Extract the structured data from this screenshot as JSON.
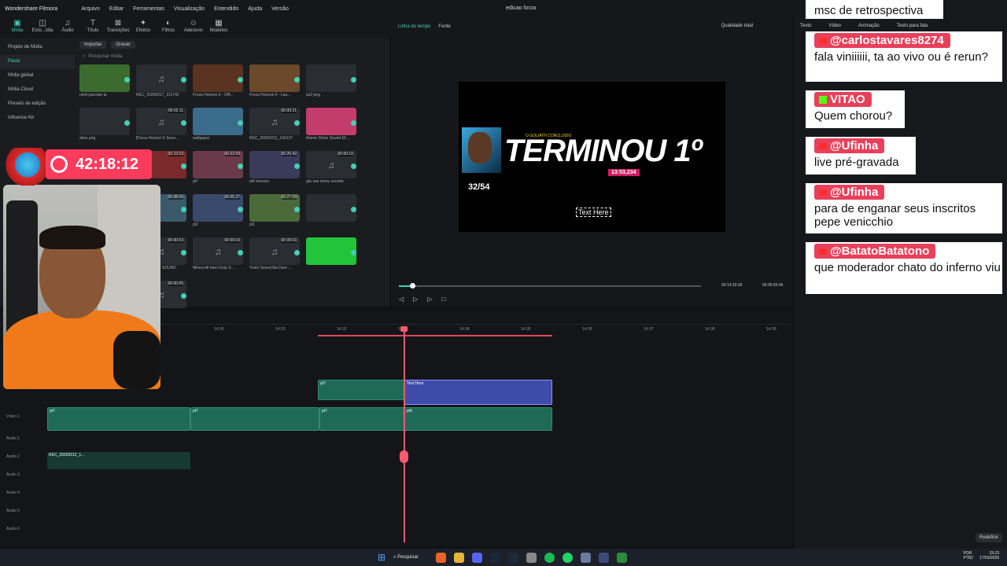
{
  "app": {
    "title": "Wondershare Filmora",
    "doc_title": "edicao forza"
  },
  "menu": [
    "Arquivo",
    "Editar",
    "Ferramentas",
    "Visualização",
    "Estendido",
    "Ajuda",
    "Versão"
  ],
  "toolbar": [
    {
      "icon": "media-icon",
      "label": "Mídia"
    },
    {
      "icon": "stock-icon",
      "label": "Esto...ídia"
    },
    {
      "icon": "audio-icon",
      "label": "Áudio"
    },
    {
      "icon": "title-icon",
      "label": "Título"
    },
    {
      "icon": "transition-icon",
      "label": "Transições"
    },
    {
      "icon": "effects-icon",
      "label": "Efeitos"
    },
    {
      "icon": "filters-icon",
      "label": "Filtros"
    },
    {
      "icon": "stickers-icon",
      "label": "Adesivos"
    },
    {
      "icon": "templates-icon",
      "label": "Modelos"
    }
  ],
  "sidebar": {
    "items": [
      "Projeto de Mídia",
      "Pasta",
      "Mídia global",
      "Mídia Cloud",
      "Presets de edição",
      "Influence Kit"
    ]
  },
  "media": {
    "import": "Importar",
    "record": "Gravar",
    "search_placeholder": "Pesquisar mídia",
    "items": [
      {
        "name": "nerd pacman ia",
        "dur": "",
        "icon": "image-icon"
      },
      {
        "name": "REC_20260217_211742",
        "dur": "",
        "icon": "music-icon"
      },
      {
        "name": "Forza Horizon 6 - Offi...",
        "dur": "",
        "icon": "video-icon"
      },
      {
        "name": "Forza Horizon 5 - Lau...",
        "dur": "",
        "icon": "video-icon"
      },
      {
        "name": "ps3 png",
        "dur": "",
        "icon": "image-icon"
      },
      {
        "name": "xbox png",
        "dur": "",
        "icon": "image-icon"
      },
      {
        "name": "[Forza Horizon 5 Soun...",
        "dur": "00:02:11",
        "icon": "music-icon"
      },
      {
        "name": "wallpaper",
        "dur": "",
        "icon": "image-icon"
      },
      {
        "name": "REC_20260212_160137",
        "dur": "00:00:21",
        "icon": "music-icon"
      },
      {
        "name": "Anime Shine Sound Ef...",
        "dur": "",
        "icon": "image-icon"
      },
      {
        "name": "",
        "dur": "00:00:01",
        "icon": "video-icon"
      },
      {
        "name": "",
        "dur": "00:22:03",
        "icon": "video-icon"
      },
      {
        "name": "pt7",
        "dur": "00:02:59",
        "icon": "video-icon"
      },
      {
        "name": "pt6 tesouro",
        "dur": "00:25:42",
        "icon": "video-icon"
      },
      {
        "name": "gta san menu sounds",
        "dur": "00:00:10",
        "icon": "music-icon"
      },
      {
        "name": "",
        "dur": "00:23:58",
        "icon": "video-icon"
      },
      {
        "name": "pt3",
        "dur": "00:08:00",
        "icon": "video-icon"
      },
      {
        "name": "pt2",
        "dur": "00:05:37",
        "icon": "video-icon"
      },
      {
        "name": "pt1",
        "dur": "00:27:09",
        "icon": "video-icon"
      },
      {
        "name": "",
        "dur": "",
        "icon": "video-icon"
      },
      {
        "name": "Sounds",
        "dur": "00:00:10",
        "icon": "music-icon"
      },
      {
        "name": "PS3 TROPHY SOUND",
        "dur": "00:00:03",
        "icon": "music-icon"
      },
      {
        "name": "Minecraft Item Drop S...",
        "dur": "00:00:03",
        "icon": "music-icon"
      },
      {
        "name": "Yoshi Sound Ba-Dum ...",
        "dur": "00:00:03",
        "icon": "music-icon"
      },
      {
        "name": "",
        "dur": "",
        "icon": "image-icon"
      },
      {
        "name": "",
        "dur": "",
        "icon": "image-icon"
      },
      {
        "name": "",
        "dur": "00:00:05",
        "icon": "music-icon"
      }
    ]
  },
  "preview": {
    "tab_timeline": "Linha do tempo",
    "tab_font": "Fonte",
    "quality": "Qualidade total",
    "current_time": "00:14:33:06",
    "total_time": "06:06:55:46",
    "progress": 0.045,
    "overlay": {
      "title": "TERMINOU 1º",
      "time": "13:53,234",
      "goliath": "O GOLIATH CONCLUIDO",
      "counter": "32/54",
      "text_here": "Text Here"
    }
  },
  "timeline": {
    "ruler": [
      "14:30",
      "14:31",
      "14:32",
      "14:33",
      "14:34",
      "14:35",
      "14:36",
      "14:37",
      "14:38",
      "14:39"
    ],
    "tracks": [
      "Vídeo 1",
      "Áudio 1",
      "Áudio 2",
      "Áudio 3",
      "Áudio 4",
      "Áudio 5",
      "Áudio 6"
    ],
    "clips": {
      "text": "Text Here",
      "pt7": "pt7",
      "pt6": "pt6",
      "rec": "REC_20260212_1..."
    }
  },
  "overlay": {
    "timer": "42:18:12"
  },
  "right_panel": {
    "tabs": [
      "Texto",
      "Vídeo",
      "Animação",
      "Texto para fala"
    ],
    "redefine": "Redefinir"
  },
  "chat": [
    {
      "name": "",
      "message": "msc de retrospectiva",
      "platform": "youtube"
    },
    {
      "name": "@carlostavares8274",
      "message": "fala viniiiiii, ta ao vivo ou é rerun?",
      "platform": "youtube"
    },
    {
      "name": "VITAO",
      "message": "Quem chorou?",
      "platform": "kick"
    },
    {
      "name": "@Ufinha",
      "message": "live pré-gravada",
      "platform": "youtube"
    },
    {
      "name": "@Ufinha",
      "message": "para de enganar seus inscritos pepe venicchio",
      "platform": "youtube"
    },
    {
      "name": "@BatatoBatatono",
      "message": "que moderador chato do inferno viu",
      "platform": "youtube"
    }
  ],
  "taskbar": {
    "search": "Pesquisar",
    "lang": "POR",
    "kbd": "PTB2",
    "time": "15:23",
    "date": "17/03/2026"
  },
  "colors": {
    "accent": "#41d0b5",
    "chat_name": "#e8405b",
    "timer": "#ff3b5c",
    "playhead": "#ff5b6e"
  }
}
